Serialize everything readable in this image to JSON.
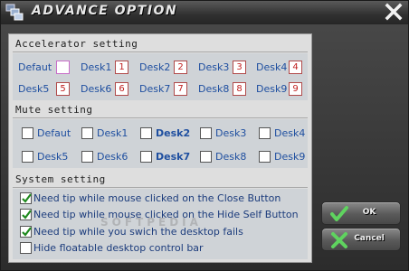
{
  "title": "ADVANCE OPTION",
  "icons": {
    "app": "desktop-windows-icon",
    "close": "close-icon",
    "ok": "checkmark-icon",
    "cancel": "cross-icon"
  },
  "colors": {
    "label_blue": "#1f4fa0",
    "key_red": "#c02020",
    "check_green": "#1f8a1f",
    "panel_bg": "#dedede",
    "titlebar_dark": "#262626"
  },
  "accelerator": {
    "title": "Accelerator setting",
    "items": [
      {
        "label": "Defaut",
        "key": ""
      },
      {
        "label": "Desk1",
        "key": "1"
      },
      {
        "label": "Desk2",
        "key": "2"
      },
      {
        "label": "Desk3",
        "key": "3"
      },
      {
        "label": "Desk4",
        "key": "4"
      },
      {
        "label": "Desk5",
        "key": "5"
      },
      {
        "label": "Desk6",
        "key": "6"
      },
      {
        "label": "Desk7",
        "key": "7"
      },
      {
        "label": "Desk8",
        "key": "8"
      },
      {
        "label": "Desk9",
        "key": "9"
      }
    ]
  },
  "mute": {
    "title": "Mute setting",
    "items": [
      {
        "label": "Defaut",
        "checked": false,
        "bold": false
      },
      {
        "label": "Desk1",
        "checked": false,
        "bold": false
      },
      {
        "label": "Desk2",
        "checked": false,
        "bold": true
      },
      {
        "label": "Desk3",
        "checked": false,
        "bold": false
      },
      {
        "label": "Desk4",
        "checked": false,
        "bold": false
      },
      {
        "label": "Desk5",
        "checked": false,
        "bold": false
      },
      {
        "label": "Desk6",
        "checked": false,
        "bold": false
      },
      {
        "label": "Desk7",
        "checked": false,
        "bold": true
      },
      {
        "label": "Desk8",
        "checked": false,
        "bold": false
      },
      {
        "label": "Desk9",
        "checked": false,
        "bold": false
      }
    ]
  },
  "system": {
    "title": "System setting",
    "items": [
      {
        "label": "Need tip while mouse clicked on the Close Button",
        "checked": true
      },
      {
        "label": "Need tip while mouse clicked on the Hide Self Button",
        "checked": true
      },
      {
        "label": "Need tip while you swich the desktop fails",
        "checked": true
      },
      {
        "label": "Hide floatable desktop control bar",
        "checked": false
      }
    ]
  },
  "buttons": {
    "ok_label": "OK",
    "cancel_label": "Cancel"
  },
  "watermark": "SOFTPEDIA"
}
